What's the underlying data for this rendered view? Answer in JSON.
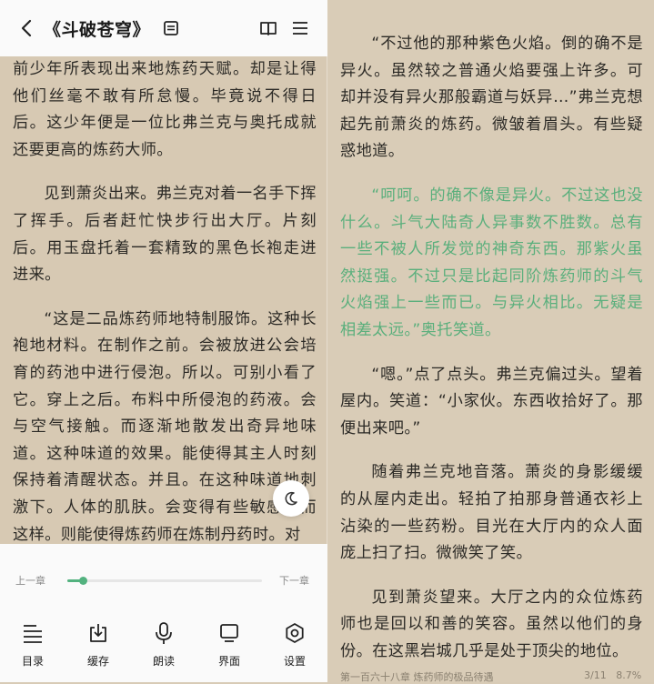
{
  "header": {
    "title": "《斗破苍穹》"
  },
  "left_page": {
    "paragraphs": [
      "前少年所表现出来地炼药天赋。却是让得他们丝毫不敢有所怠慢。毕竟说不得日后。这少年便是一位比弗兰克与奥托成就还要更高的炼药大师。",
      "见到萧炎出来。弗兰克对着一名手下挥了挥手。后者赶忙快步行出大厅。片刻后。用玉盘托着一套精致的黑色长袍走进进来。",
      "“这是二品炼药师地特制服饰。这种长袍地材料。在制作之前。会被放进公会培育的药池中进行侵泡。所以。可别小看了它。穿上之后。布料中所侵泡的药液。会与空气接触。而逐渐地散发出奇异地味道。这种味道的效果。能使得其主人时刻保持着清醒状态。并且。在这种味道地刺激下。人体的肌肤。会变得有些敏感。而这样。则能使得炼药师在炼制丹药时。对"
    ]
  },
  "right_page": {
    "paragraphs": [
      "“不过他的那种紫色火焰。倒的确不是异火。虽然较之普通火焰要强上许多。可却并没有异火那般霸道与妖异…”弗兰克想起先前萧炎的炼药。微皱着眉头。有些疑惑地道。",
      "“呵呵。的确不像是异火。不过这也没什么。斗气大陆奇人异事数不胜数。总有一些不被人所发觉的神奇东西。那紫火虽然挺强。不过只是比起同阶炼药师的斗气火焰强上一些而已。与异火相比。无疑是相差太远。”奥托笑道。",
      "“嗯。”点了点头。弗兰克偏过头。望着屋内。笑道：“小家伙。东西收拾好了。那便出来吧。”",
      "随着弗兰克地音落。萧炎的身影缓缓的从屋内走出。轻拍了拍那身普通衣衫上沾染的一些药粉。目光在大厅内的众人面庞上扫了扫。微微笑了笑。",
      "见到萧炎望来。大厅之内的众位炼药师也是回以和善的笑容。虽然以他们的身份。在这黑岩城几乎是处于顶尖的地位。"
    ]
  },
  "footer": {
    "chapter": "第一百六十八章 炼药师的极品待遇",
    "page": "3/11",
    "percent": "8.7%"
  },
  "progress": {
    "prev_label": "上一章",
    "next_label": "下一章",
    "value": 0.08
  },
  "toolbar": [
    {
      "label": "目录",
      "icon": "list-icon"
    },
    {
      "label": "缓存",
      "icon": "download-icon"
    },
    {
      "label": "朗读",
      "icon": "microphone-icon"
    },
    {
      "label": "界面",
      "icon": "display-icon"
    },
    {
      "label": "设置",
      "icon": "gear-icon"
    }
  ],
  "colors": {
    "accent": "#53b27f",
    "highlight_text": "#5aaf7c",
    "paper": "#d7c9b3"
  }
}
